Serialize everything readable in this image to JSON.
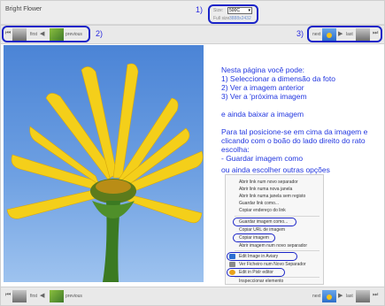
{
  "header": {
    "title": "Bright Flower",
    "annotation_1": "1)",
    "size_label": "Size:",
    "size_value": "500C",
    "full_size_label": "Full size:",
    "full_size_value": "3888x2432"
  },
  "top_nav": {
    "first": "first",
    "previous": "previous",
    "next": "next",
    "last": "last",
    "annotation_2": "2)",
    "annotation_3": "3)"
  },
  "bottom_nav": {
    "first": "first",
    "previous": "previous",
    "next": "next",
    "last": "last"
  },
  "instructions": {
    "line1": "Nesta página você pode:",
    "line2": "1) Seleccionar a dimensão da foto",
    "line3": "2) Ver a imagem anterior",
    "line4": "3) Ver a 'próxima imagem",
    "line5": "e ainda baixar a imagem",
    "line6": "Para tal posicione-se em cima da imagem e",
    "line7": "clicando com o boão do lado direito do rato",
    "line8": "escolha:",
    "line9": "- Guardar imagem como",
    "line10": "ou ainda escolher outras opções"
  },
  "context_menu": {
    "items": [
      "Abrir link num novo separador",
      "Abrir link numa nova janela",
      "Abrir link numa janela sem registo",
      "Guardar link como...",
      "Copiar endereço do link",
      "Guardar imagem como...",
      "Copiar URL de imagem",
      "Copiar imagem",
      "Abrir imagem num novo separador",
      "Edit Image in Aviary",
      "Ver Ficheiro num Novo Separador",
      "Edit in Pixlr editor",
      "Inspeccionar elemento"
    ]
  },
  "colors": {
    "annotation_blue": "#1a24c8",
    "instruction_text": "#2136e0",
    "header_bg": "#ececec",
    "sky_blue": "#4b84d6",
    "petal_yellow": "#f6d21f"
  }
}
